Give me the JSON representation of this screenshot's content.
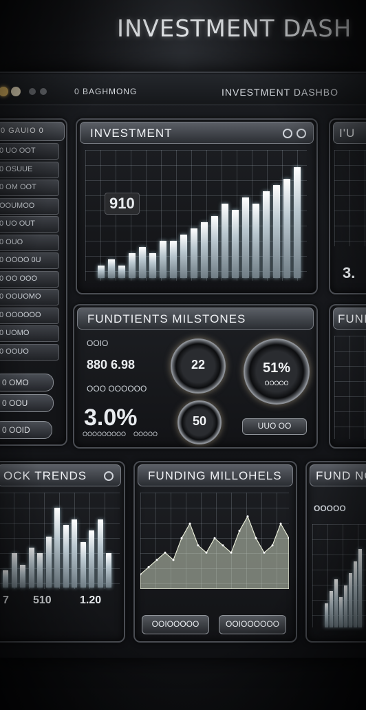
{
  "header": {
    "title": "INVESTMENT DASH"
  },
  "topbar": {
    "left_label": "0 BAGHMONG",
    "right_label": "INVESTMENT DASHBO"
  },
  "sidebar": {
    "header": "0 GAUIO 0",
    "items": [
      "0 UO OOT",
      "0 OSUUE",
      "0 OM OOT",
      "OOUMOO",
      "0 UO OUT",
      "0 OUO",
      "0 OOOO 0U",
      "0 OO OOO",
      "0 OOUOMO",
      "0 OOOOOO",
      "0 UOMO",
      "0 OOUO"
    ],
    "pills": [
      "0 OMO",
      "0 OOU",
      "0 OOID"
    ]
  },
  "panels": {
    "investment": {
      "title": "INVESTMENT",
      "value_label": "910"
    },
    "top_right": {
      "title": "I'U",
      "value": "3."
    },
    "milestones": {
      "title": "FUNDTIENTS MILSTONES",
      "stat_small": "OOIO",
      "stat_mid": "880 6.98",
      "stat_sub": "OOO OOOOOO",
      "gauge_1": "22",
      "gauge_2": "51%",
      "gauge_2_sub": "OOOOO",
      "gauge_3": "50",
      "big_pct": "3.0%",
      "big_sub_left": "OOOOOOOOO",
      "big_sub_right": "OOOOO",
      "button": "UUO OO"
    },
    "right_mid": {
      "title": "FUNI"
    },
    "stock_trends": {
      "title": "OCK TRENDS",
      "labels": [
        "7",
        "510",
        "1.20"
      ]
    },
    "funding": {
      "title": "FUNDING MILLOHELS",
      "buttons": [
        "OOIOOOOO",
        "OOIOOOOOO"
      ]
    },
    "fund_right": {
      "title": "FUND NG",
      "label": "OOOOO"
    }
  },
  "chart_data": [
    {
      "type": "bar",
      "title": "INVESTMENT",
      "values": [
        2,
        3,
        2,
        4,
        5,
        4,
        6,
        6,
        7,
        8,
        9,
        10,
        12,
        11,
        13,
        12,
        14,
        15,
        16,
        18
      ]
    },
    {
      "type": "bar",
      "title": "OCK TRENDS",
      "values": [
        3,
        6,
        4,
        7,
        6,
        9,
        14,
        11,
        12,
        8,
        10,
        12,
        6
      ]
    },
    {
      "type": "area",
      "title": "FUNDING MILLOHELS",
      "values": [
        2,
        3,
        4,
        5,
        4,
        7,
        9,
        6,
        5,
        7,
        6,
        5,
        8,
        10,
        7,
        5,
        6,
        9,
        7
      ]
    },
    {
      "type": "bar",
      "title": "FUND NG",
      "values": [
        4,
        6,
        8,
        5,
        7,
        9,
        11,
        13
      ]
    }
  ],
  "colors": {
    "accent": "#cfe9f2",
    "panel_border": "#4a4d53",
    "glow": "#f0c98a"
  }
}
